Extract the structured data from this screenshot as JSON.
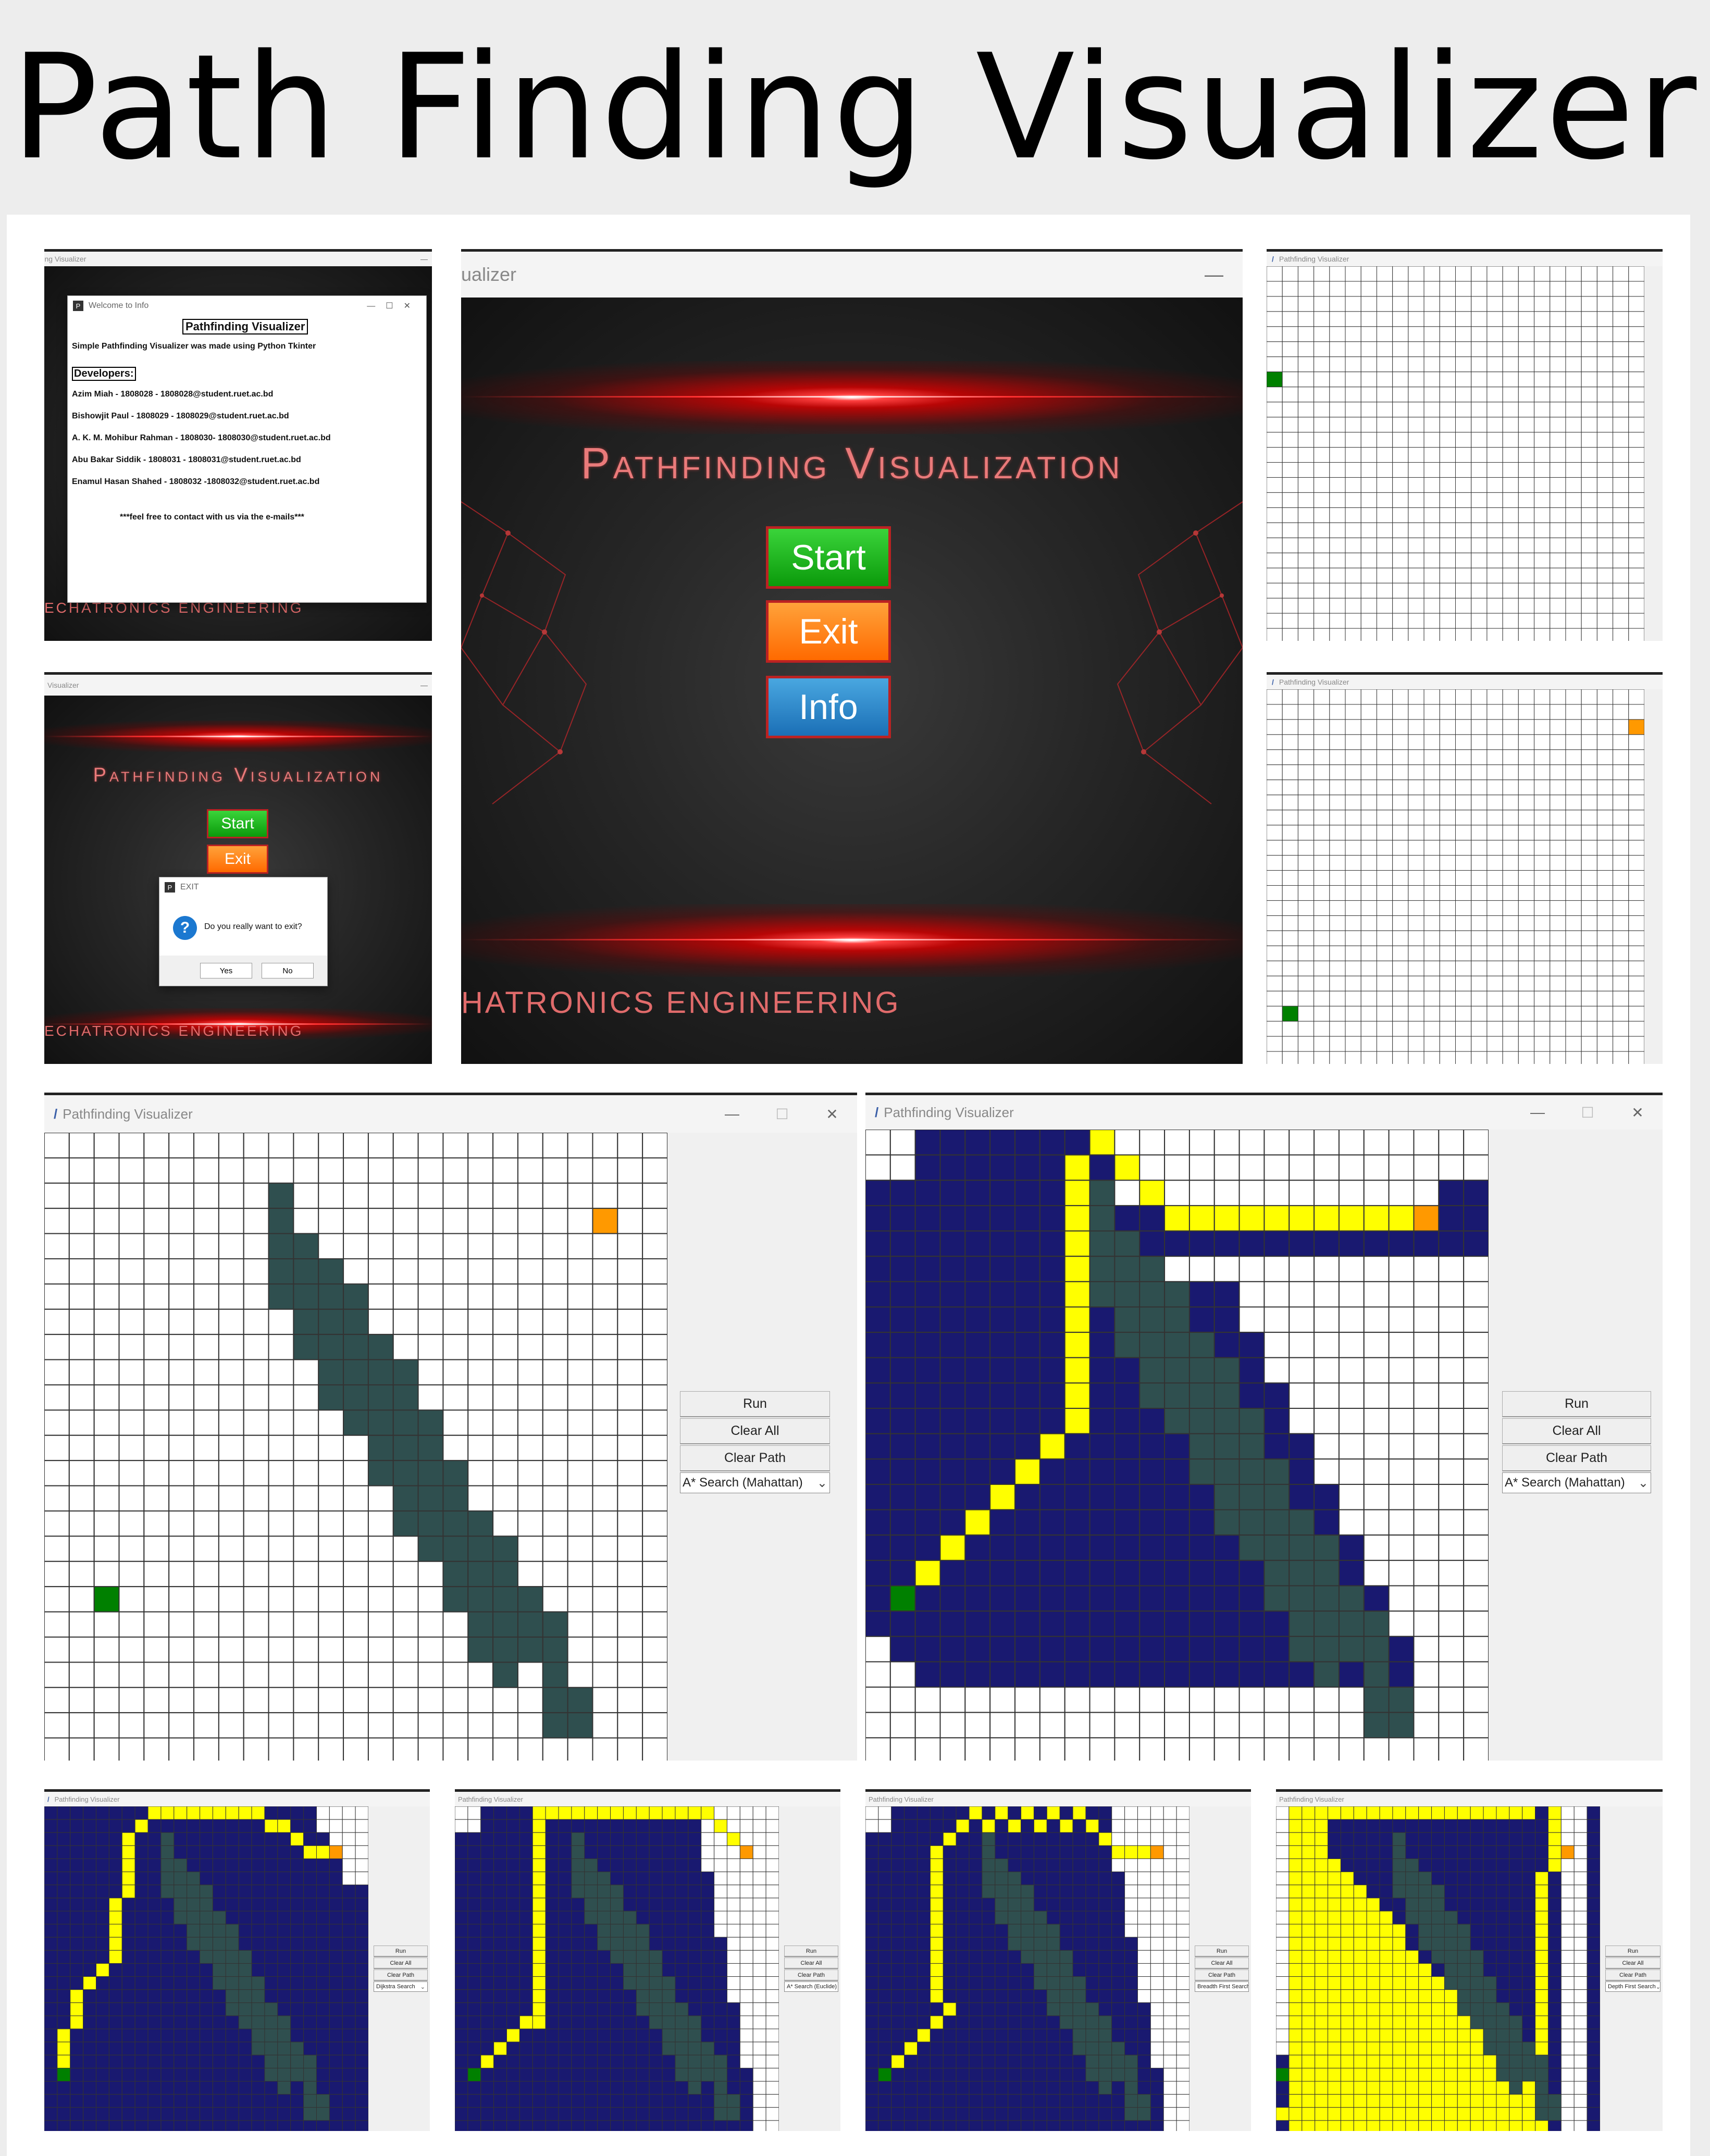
{
  "header": {
    "title": "Path Finding Visualizer"
  },
  "app": {
    "window_title": "Pathfinding Visualizer",
    "window_title_cut": "ualizer",
    "window_title_cut2": "Visualizer",
    "heading": "Pathfinding Visualization",
    "start_label": "Start",
    "exit_label": "Exit",
    "info_label": "Info",
    "footer_cut": "HATRONICS ENGINEERING",
    "footer_cut2": "ECHATRONICS ENGINEERING"
  },
  "info_dialog": {
    "title": "Welcome to Info",
    "heading": "Pathfinding Visualizer",
    "intro": "Simple Pathfinding Visualizer was made using Python Tkinter",
    "dev_heading": "Developers:",
    "developers": [
      "Azim Miah - 1808028 - 1808028@student.ruet.ac.bd",
      "Bishowjit Paul - 1808029 - 1808029@student.ruet.ac.bd",
      "A. K. M. Mohibur Rahman - 1808030- 1808030@student.ruet.ac.bd",
      "Abu Bakar Siddik - 1808031 - 1808031@student.ruet.ac.bd",
      "Enamul Hasan Shahed - 1808032 -1808032@student.ruet.ac.bd"
    ],
    "note": "***feel free to contact with us via the e-mails***"
  },
  "exit_dialog": {
    "title": "EXIT",
    "question": "Do you really want to exit?",
    "yes": "Yes",
    "no": "No",
    "icon": "question-icon"
  },
  "controls": {
    "run": "Run",
    "clear_all": "Clear All",
    "clear_path": "Clear Path"
  },
  "algorithms": {
    "astar_manhattan": "A* Search (Mahattan)",
    "dijkstra": "Dijkstra Search",
    "astar_euclid": "A* Search (Euclide)",
    "bfs": "Breadth First Search",
    "dfs": "Depth First Search"
  },
  "colors": {
    "start": "#008000",
    "end": "#ff9900",
    "wall": "#2f4f4f",
    "visited": "#191970",
    "path": "#ffff00",
    "grid_line": "#333333"
  },
  "icons": [
    "feather-icon",
    "minimize-icon",
    "maximize-icon",
    "close-icon",
    "question-icon"
  ]
}
